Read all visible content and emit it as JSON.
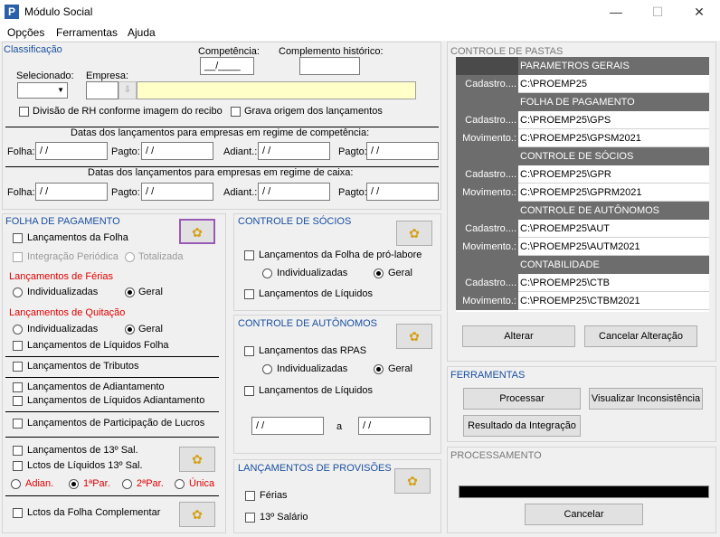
{
  "window": {
    "title": "Módulo Social",
    "minimize": "—",
    "maximize": "☐",
    "close": "✕",
    "icon_letter": "P"
  },
  "menu": [
    "Opções",
    "Ferramentas",
    "Ajuda"
  ],
  "classificacao": {
    "title": "Classificação",
    "competencia_label": "Competência:",
    "competencia_value": "__/____",
    "complemento_label": "Complemento histórico:",
    "selecionado_label": "Selecionado:",
    "empresa_label": "Empresa:",
    "divisao_label": "Divisão de RH conforme imagem do recibo",
    "grava_label": "Grava origem dos lançamentos"
  },
  "datas_comp": {
    "title": "Datas dos lançamentos para empresas em regime de competência:",
    "folha": "Folha:",
    "pagto1": "Pagto:",
    "adiant": "Adiant.:",
    "pagto2": "Pagto:",
    "date": " / /"
  },
  "datas_caixa": {
    "title": "Datas dos lançamentos para empresas em regime de caixa:",
    "folha": "Folha:",
    "pagto1": "Pagto:",
    "adiant": "Adiant.:",
    "pagto2": "Pagto:",
    "date": " / /"
  },
  "folha": {
    "title": "FOLHA DE PAGAMENTO",
    "lanc_folha": "Lançamentos da Folha",
    "integ_periodica": "Integração Periódica",
    "totalizada": "Totalizada",
    "ferias_title": "Lançamentos de Férias",
    "individualizadas": "Individualizadas",
    "geral": "Geral",
    "quitacao_title": "Lançamentos de Quitação",
    "liq_folha": "Lançamentos de Líquidos Folha",
    "tributos": "Lançamentos de Tributos",
    "adiantamento": "Lançamentos de Adiantamento",
    "liq_adiantamento": "Lançamentos de Líquidos Adiantamento",
    "part_lucros": "Lançamentos de Participação de Lucros",
    "sal13": "Lançamentos de 13º Sal.",
    "liq13": "Lctos de Líquidos 13º Sal.",
    "adian": "Adian.",
    "par1": "1ªPar.",
    "par2": "2ªPar.",
    "unica": "Única",
    "complementar": "Lctos da Folha Complementar"
  },
  "socios": {
    "title": "CONTROLE DE SÓCIOS",
    "pro_labore": "Lançamentos da Folha de pró-labore",
    "individualizadas": "Individualizadas",
    "geral": "Geral",
    "liquidos": "Lançamentos de Líquidos"
  },
  "autonomos": {
    "title": "CONTROLE DE AUTÔNOMOS",
    "rpas": "Lançamentos das RPAS",
    "individualizadas": "Individualizadas",
    "geral": "Geral",
    "liquidos": "Lançamentos de Líquidos",
    "date": " / /",
    "a": "a"
  },
  "provisoes": {
    "title": "LANÇAMENTOS DE PROVISÕES",
    "ferias": "Férias",
    "decimo": "13º Salário"
  },
  "pastas": {
    "title": "CONTROLE DE PASTAS",
    "alterar": "Alterar",
    "cancelar": "Cancelar Alteração",
    "rows": [
      {
        "h": "PARAMETROS GERAIS"
      },
      {
        "l": "Cadastro....",
        "v": "C:\\PROEMP25"
      },
      {
        "h": "FOLHA DE PAGAMENTO"
      },
      {
        "l": "Cadastro....",
        "v": "C:\\PROEMP25\\GPS"
      },
      {
        "l": "Movimento.:",
        "v": "C:\\PROEMP25\\GPSM2021"
      },
      {
        "h": "CONTROLE DE SÓCIOS"
      },
      {
        "l": "Cadastro....",
        "v": "C:\\PROEMP25\\GPR"
      },
      {
        "l": "Movimento.:",
        "v": "C:\\PROEMP25\\GPRM2021"
      },
      {
        "h": "CONTROLE DE AUTÔNOMOS"
      },
      {
        "l": "Cadastro....",
        "v": "C:\\PROEMP25\\AUT"
      },
      {
        "l": "Movimento.:",
        "v": "C:\\PROEMP25\\AUTM2021"
      },
      {
        "h": "CONTABILIDADE"
      },
      {
        "l": "Cadastro....",
        "v": "C:\\PROEMP25\\CTB"
      },
      {
        "l": "Movimento.:",
        "v": "C:\\PROEMP25\\CTBM2021"
      }
    ]
  },
  "ferramentas": {
    "title": "FERRAMENTAS",
    "processar": "Processar",
    "visualizar": "Visualizar Inconsistência",
    "resultado": "Resultado da Integração"
  },
  "processamento": {
    "title": "PROCESSAMENTO",
    "cancelar": "Cancelar"
  }
}
